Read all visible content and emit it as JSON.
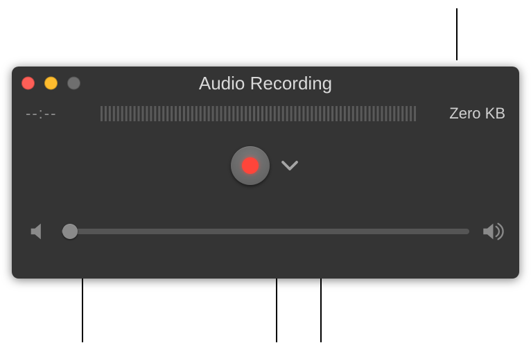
{
  "window": {
    "title": "Audio Recording"
  },
  "status": {
    "elapsed": "--:--",
    "filesize": "Zero KB"
  },
  "volume": {
    "value_percent": 2
  },
  "callouts": {
    "record": "",
    "options": "",
    "volume": "",
    "filesize": ""
  }
}
